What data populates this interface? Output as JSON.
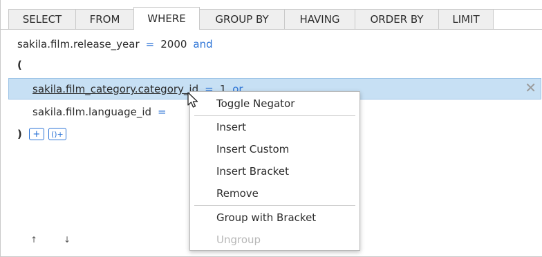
{
  "tabs": [
    {
      "label": "SELECT",
      "active": false
    },
    {
      "label": "FROM",
      "active": false
    },
    {
      "label": "WHERE",
      "active": true
    },
    {
      "label": "GROUP BY",
      "active": false
    },
    {
      "label": "HAVING",
      "active": false
    },
    {
      "label": "ORDER BY",
      "active": false
    },
    {
      "label": "LIMIT",
      "active": false
    }
  ],
  "conditions": {
    "row1": {
      "field": "sakila.film.release_year",
      "operator": "=",
      "value": "2000",
      "conjunction": "and"
    },
    "open_bracket": "(",
    "row2": {
      "field": "sakila.film_category.category_id",
      "operator": "=",
      "value": "1",
      "conjunction": "or"
    },
    "row3": {
      "field": "sakila.film.language_id",
      "operator": "="
    },
    "close_bracket": ")",
    "add_condition_label": "+",
    "add_bracket_label": "()+",
    "remove_label": "✕"
  },
  "move_controls": {
    "up": "↑",
    "down": "↓"
  },
  "context_menu": {
    "items": [
      {
        "label": "Toggle Negator",
        "enabled": true
      },
      {
        "label": "Insert",
        "enabled": true
      },
      {
        "label": "Insert Custom",
        "enabled": true
      },
      {
        "label": "Insert Bracket",
        "enabled": true
      },
      {
        "label": "Remove",
        "enabled": true
      },
      {
        "label": "Group with Bracket",
        "enabled": true
      },
      {
        "label": "Ungroup",
        "enabled": false
      }
    ]
  },
  "colors": {
    "accent": "#2b73d6",
    "selection": "#c7e0f4",
    "border": "#c9c9c9"
  }
}
